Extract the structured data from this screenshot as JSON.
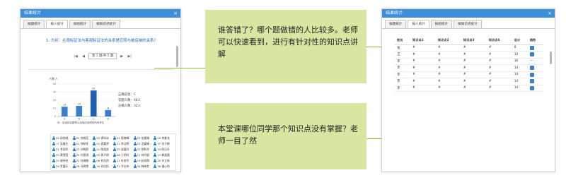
{
  "left_window": {
    "title": "结果统计",
    "close": "×",
    "tabs": [
      "按题统计",
      "按人统计",
      "按组统计",
      "按知识点统计"
    ],
    "active_tab": 1,
    "question": "1. 为何：主观标证法与客观标证法的关系是应转与被反映的关系？",
    "pager": {
      "first": "|◀",
      "prev": "◀",
      "page_text": "第 1 题/共 5 题",
      "next": "▶",
      "last": "▶|"
    },
    "stats": {
      "correct_answer": "正确答案：C",
      "answered": "答题人数：68人",
      "correct_count": "正确人数：32人"
    },
    "names": [
      "02 邱奕嫣",
      "02 何晓苑",
      "03 谭冰冰",
      "04 奥晓峰",
      "03 张紫瑜",
      "05 李紫龙",
      "17 吴鑫生",
      "01 何耿亮",
      "01 麦嘉娇",
      "22 李洁明",
      "22 龙蔓娟",
      "37 张子枫",
      "21 李丽华",
      "23 刘晓燕",
      "01 陈国良",
      "05 梁嘉玲",
      "22 黎佩华",
      "33 陈日升",
      "25 黄雪莹",
      "25 刘思琪",
      "05 周子琪",
      "08 王明轩",
      "12 林丹妮",
      "17 郭逸晨",
      "25 谢伟杰",
      "22 杜婉瑜",
      "08 何浩然",
      "11 叶俊华",
      "19 赵雨萌",
      "20 孙立新",
      "26 罗嘉乐",
      "28 冯晓雪",
      "30 邓佳怡",
      "31 许志伟",
      "34 韩晓冬",
      "36 潘心怡"
    ]
  },
  "chart_data": {
    "type": "bar",
    "title": "",
    "ylabel": "人数/人",
    "categories": [
      "A",
      "B",
      "C",
      "D"
    ],
    "values": [
      12,
      13,
      32,
      8
    ],
    "ylim": [
      0,
      40
    ],
    "yticks": [
      0,
      10,
      20,
      30,
      40
    ],
    "legend": "你 : 这选择答题率以及相应选项的所有学生",
    "colors": {
      "bar": "#3a7fce",
      "highlight": "#1f5fae"
    }
  },
  "callouts": [
    "谁答错了？哪个题做错的人比较多。老师可以快速看到，进行有针对性的知识点讲解",
    "本堂课哪位同学那个知识点没有掌握？老师一目了然"
  ],
  "right_window": {
    "title": "结果统计",
    "close": "×",
    "tabs": [
      "按题统计",
      "按人统计",
      "按组统计",
      "按知识点统计"
    ],
    "active_tab": 1,
    "columns": [
      "姓名",
      "知识点1",
      "知识点2",
      "知识点3",
      "知识点4",
      "总分",
      "趋势"
    ],
    "rows": [
      [
        "张",
        "#",
        "#",
        "#",
        "#",
        "8",
        "btn"
      ],
      [
        "王",
        "#",
        "#",
        "#",
        "#",
        "10",
        "btn"
      ],
      [
        "李",
        "#",
        "#",
        "#",
        "#",
        "16",
        "—"
      ],
      [
        "李",
        "#",
        "#",
        "#",
        "#",
        "14",
        "btn"
      ],
      [
        "李",
        "#",
        "#",
        "#",
        "#",
        "14",
        "btn"
      ],
      [
        "李",
        "#",
        "#",
        "#",
        "#",
        "14",
        "btn"
      ],
      [
        "李",
        "#",
        "#",
        "#",
        "#",
        "14",
        "btn"
      ]
    ],
    "row_marks": [
      [
        "r",
        "r",
        "r",
        "r"
      ],
      [
        "r",
        "r",
        "r",
        "r"
      ],
      [
        "g",
        "g",
        "g",
        "g"
      ],
      [
        "g",
        "r",
        "g",
        "r"
      ],
      [
        "r",
        "g",
        "r",
        "g"
      ],
      [
        "g",
        "r",
        "g",
        "g"
      ],
      [
        "r",
        "g",
        "g",
        "g"
      ]
    ],
    "colors": {
      "wrong": "#d83030",
      "right": "#2ea13e"
    }
  }
}
